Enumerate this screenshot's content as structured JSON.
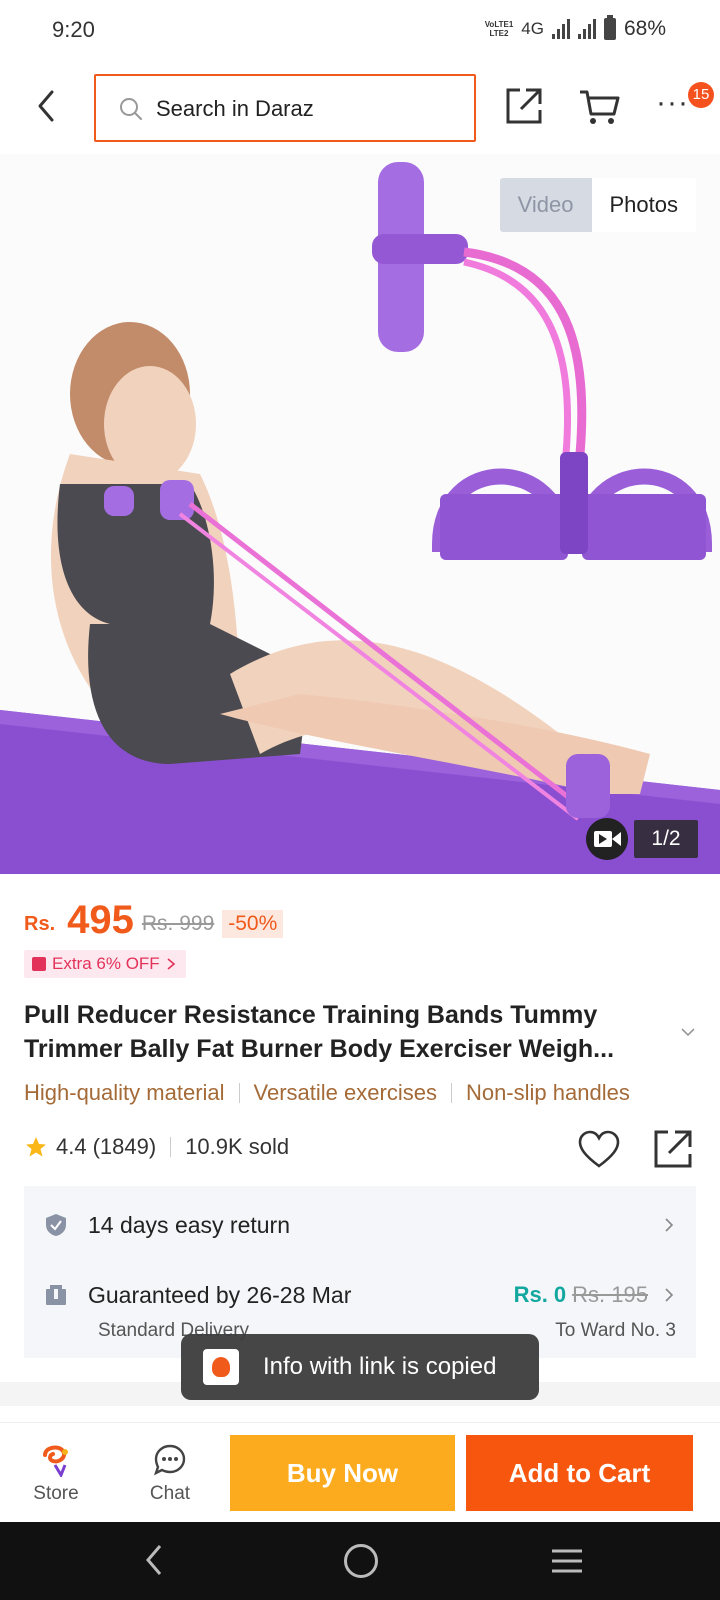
{
  "status": {
    "time": "9:20",
    "volte_line1": "VoLTE1",
    "volte_line2": "LTE2",
    "network": "4G",
    "battery": "68%"
  },
  "header": {
    "search_placeholder": "Search in Daraz",
    "more_badge_count": "15"
  },
  "gallery": {
    "tabs": [
      "Video",
      "Photos"
    ],
    "active_tab": "Photos",
    "page_indicator": "1/2"
  },
  "price": {
    "currency": "Rs.",
    "current": "495",
    "original": "Rs. 999",
    "discount": "-50%",
    "extra_offer": "Extra 6% OFF"
  },
  "product": {
    "title_line1": "Pull Reducer Resistance Training Bands Tummy",
    "title_line2": "Trimmer Bally Fat Burner Body Exerciser Weigh...",
    "tags": [
      "High-quality material",
      "Versatile exercises",
      "Non-slip handles"
    ],
    "rating": "4.4",
    "reviews": "(1849)",
    "sold": "10.9K sold"
  },
  "service": {
    "return_text": "14 days easy return",
    "delivery_text": "Guaranteed by 26-28 Mar",
    "delivery_type": "Standard Delivery",
    "shipping_fee": "Rs. 0",
    "shipping_original": "Rs. 195",
    "destination": "To Ward No. 3"
  },
  "toast": {
    "message": "Info with link is copied"
  },
  "action_bar": {
    "store_label": "Store",
    "chat_label": "Chat",
    "buy_now_label": "Buy Now",
    "add_to_cart_label": "Add to Cart"
  },
  "colors": {
    "brand_orange": "#f05a1b",
    "buy_now": "#fbab1d",
    "add_to_cart": "#f6560d",
    "free_shipping": "#14a7a0",
    "mat_purple": "#8a4fd0"
  }
}
